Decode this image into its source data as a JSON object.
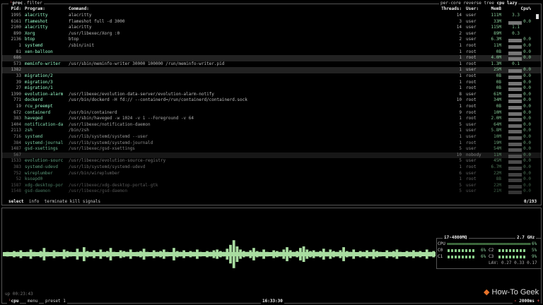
{
  "proc": {
    "title": "proc",
    "filter": "filter",
    "options": [
      "per-core",
      "reverse",
      "tree",
      "cpu lazy"
    ],
    "headers": {
      "pid": "Pid:",
      "program": "Program:",
      "command": "Command:",
      "threads": "Threads:",
      "user": "User:",
      "mem": "MemB",
      "cpu": "Cpu%"
    },
    "rows": [
      {
        "pid": "1995",
        "program": "alacritty",
        "command": "alacritty",
        "threads": "14",
        "user": "user",
        "mem": "111M",
        "cpu": "3.3"
      },
      {
        "pid": "6161",
        "program": "flameshot",
        "command": "flameshot full -d 3000",
        "threads": "3",
        "user": "user",
        "mem": "33M",
        "cpu": "0.0"
      },
      {
        "pid": "2100",
        "program": "alacritty",
        "command": "alacritty",
        "threads": "14",
        "user": "user",
        "mem": "115M",
        "cpu": "1.1"
      },
      {
        "pid": "890",
        "program": "Xorg",
        "command": "/usr/libexec/Xorg :0",
        "threads": "2",
        "user": "user",
        "mem": "89M",
        "cpu": "0.3"
      },
      {
        "pid": "2136",
        "program": "btop",
        "command": "btop",
        "threads": "2",
        "user": "user",
        "mem": "6.3M",
        "cpu": "0.0"
      },
      {
        "pid": "1",
        "program": "systemd",
        "command": "/sbin/init",
        "threads": "1",
        "user": "root",
        "mem": "11M",
        "cpu": "0.0"
      },
      {
        "pid": "81",
        "program": "xen-balloon",
        "command": "",
        "threads": "1",
        "user": "root",
        "mem": "0B",
        "cpu": "0.0"
      },
      {
        "pid": "686",
        "program": "",
        "command": "",
        "threads": "1",
        "user": "root",
        "mem": "4.0M",
        "cpu": "0.0"
      },
      {
        "pid": "573",
        "program": "meminfo-writer",
        "command": "/usr/sbin/meminfo-writer 30000 100000 /run/meminfo-writer.pid",
        "threads": "1",
        "user": "root",
        "mem": "1.3M",
        "cpu": "0.1"
      },
      {
        "pid": "1382",
        "program": "",
        "command": "",
        "threads": "1",
        "user": "user",
        "mem": "25M",
        "cpu": "0.0"
      },
      {
        "pid": "33",
        "program": "migration/2",
        "command": "",
        "threads": "1",
        "user": "root",
        "mem": "0B",
        "cpu": "0.0"
      },
      {
        "pid": "39",
        "program": "migration/3",
        "command": "",
        "threads": "1",
        "user": "root",
        "mem": "0B",
        "cpu": "0.0"
      },
      {
        "pid": "27",
        "program": "migration/1",
        "command": "",
        "threads": "1",
        "user": "root",
        "mem": "0B",
        "cpu": "0.0"
      },
      {
        "pid": "1390",
        "program": "evolution-alarm",
        "command": "/usr/libexec/evolution-data-server/evolution-alarm-notify",
        "threads": "8",
        "user": "user",
        "mem": "61M",
        "cpu": "0.0"
      },
      {
        "pid": "771",
        "program": "dockerd",
        "command": "/usr/bin/dockerd -H fd:// --containerd=/run/containerd/containerd.sock",
        "threads": "10",
        "user": "root",
        "mem": "34M",
        "cpu": "0.0"
      },
      {
        "pid": "19",
        "program": "rcu_preempt",
        "command": "",
        "threads": "1",
        "user": "root",
        "mem": "0B",
        "cpu": "0.0"
      },
      {
        "pid": "672",
        "program": "containerd",
        "command": "/usr/bin/containerd",
        "threads": "9",
        "user": "root",
        "mem": "10M",
        "cpu": "0.0"
      },
      {
        "pid": "383",
        "program": "haveged",
        "command": "/usr/sbin/haveged -w 1024 -v 1 --Foreground -v 64",
        "threads": "1",
        "user": "root",
        "mem": "2.0M",
        "cpu": "0.0"
      },
      {
        "pid": "1404",
        "program": "notification-da",
        "command": "/usr/libexec/notification-daemon",
        "threads": "5",
        "user": "user",
        "mem": "64M",
        "cpu": "0.0"
      },
      {
        "pid": "2113",
        "program": "zsh",
        "command": "/bin/zsh",
        "threads": "1",
        "user": "user",
        "mem": "5.8M",
        "cpu": "0.0"
      },
      {
        "pid": "716",
        "program": "systemd",
        "command": "/usr/lib/systemd/systemd --user",
        "threads": "1",
        "user": "user",
        "mem": "10M",
        "cpu": "0.0"
      },
      {
        "pid": "384",
        "program": "systemd-journal",
        "command": "/usr/lib/systemd/systemd-journald",
        "threads": "1",
        "user": "root",
        "mem": "19M",
        "cpu": "0.0"
      },
      {
        "pid": "1487",
        "program": "gsd-xsettings",
        "command": "/usr/libexec/gsd-xsettings",
        "threads": "5",
        "user": "user",
        "mem": "54M",
        "cpu": "0.0"
      },
      {
        "pid": "567",
        "program": "",
        "command": "",
        "threads": "10",
        "user": "nobody",
        "mem": "11M",
        "cpu": "0.0"
      },
      {
        "pid": "1533",
        "program": "evolution-sourc",
        "command": "/usr/libexec/evolution-source-registry",
        "threads": "5",
        "user": "user",
        "mem": "45M",
        "cpu": "0.0"
      },
      {
        "pid": "383",
        "program": "systemd-udevd",
        "command": "/usr/lib/systemd/systemd-udevd",
        "threads": "1",
        "user": "root",
        "mem": "6.7M",
        "cpu": "0.0"
      },
      {
        "pid": "752",
        "program": "wireplumber",
        "command": "/usr/bin/wireplumber",
        "threads": "6",
        "user": "user",
        "mem": "22M",
        "cpu": "0.0"
      },
      {
        "pid": "52",
        "program": "ksoapd0",
        "command": "",
        "threads": "1",
        "user": "root",
        "mem": "8B",
        "cpu": "0.0"
      },
      {
        "pid": "1587",
        "program": "xdg-desktop-por",
        "command": "/usr/libexec/xdg-desktop-portal-gtk",
        "threads": "5",
        "user": "user",
        "mem": "22M",
        "cpu": "0.0"
      },
      {
        "pid": "1548",
        "program": "gsd-daemon",
        "command": "/usr/libexec/gsd-daemon",
        "threads": "5",
        "user": "user",
        "mem": "21M",
        "cpu": "0.0"
      }
    ],
    "highlight_rows": [
      7,
      9,
      23
    ],
    "footer": {
      "select": "select",
      "info": "info",
      "terminate": "terminate",
      "kill": "kill",
      "signals": "signals",
      "count": "0/193"
    }
  },
  "cpu": {
    "title": "cpu",
    "menu": "menu",
    "preset": "preset 1",
    "clock": "16:33:30",
    "interval": "2000ms",
    "uptime": "up 00:23:43",
    "model": "i7-4800MQ",
    "freq": "2.7 GHz",
    "total": {
      "label": "CPU",
      "value": "6%"
    },
    "cores": [
      {
        "label": "C0",
        "value": "6%"
      },
      {
        "label": "C1",
        "value": "6%"
      },
      {
        "label": "C2",
        "value": "5%"
      },
      {
        "label": "C3",
        "value": "9%"
      }
    ],
    "lav": "LAV: 0.27 0.33 0.17",
    "history": [
      2,
      3,
      2,
      4,
      3,
      5,
      2,
      3,
      6,
      3,
      2,
      4,
      8,
      3,
      2,
      5,
      3,
      2,
      6,
      4,
      3,
      2,
      7,
      3,
      9,
      4,
      3,
      5,
      2,
      6,
      3,
      4,
      8,
      3,
      2,
      5,
      4,
      3,
      6,
      2,
      3,
      4,
      7,
      3,
      2,
      5,
      3,
      4,
      6,
      3,
      2,
      8,
      4,
      3,
      5,
      2,
      4,
      3,
      6,
      3,
      2,
      4,
      3,
      5,
      6,
      4,
      3,
      7,
      12,
      18,
      10,
      6,
      4,
      3,
      5,
      8,
      4,
      3,
      6,
      3,
      2,
      5,
      4,
      3,
      6,
      9,
      5,
      3,
      4,
      8,
      10,
      6,
      4,
      5,
      3,
      4,
      7,
      3,
      6,
      4,
      3,
      5,
      9,
      4,
      3,
      6,
      2,
      4,
      3,
      5,
      3,
      6,
      4,
      3,
      2,
      5,
      3,
      4,
      6,
      3,
      2,
      4,
      3,
      5,
      3,
      4,
      2,
      6,
      3,
      4
    ],
    "graph_color": "#a8dca0"
  },
  "watermark": "How-To Geek"
}
